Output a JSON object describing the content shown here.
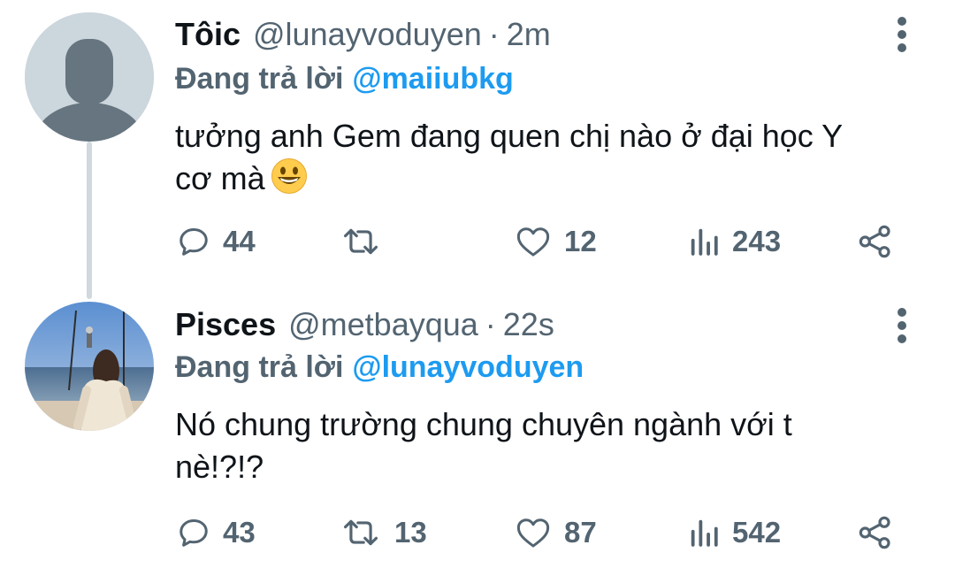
{
  "tweets": [
    {
      "display_name": "Tôic",
      "handle": "@lunayvoduyen",
      "separator": "·",
      "time": "2m",
      "replying_label": "Đang trả lời",
      "replying_to": "@maiiubkg",
      "text_line1": "tưởng anh Gem đang quen chị nào ở đại học Y",
      "text_line2": "cơ mà",
      "emoji": "grinning-face-emoji",
      "avatar": "default-avatar-icon",
      "replies": "44",
      "retweets": "",
      "likes": "12",
      "views": "243"
    },
    {
      "display_name": "Pisces",
      "handle": "@metbayqua",
      "separator": "·",
      "time": "22s",
      "replying_label": "Đang trả lời",
      "replying_to": "@lunayvoduyen",
      "text_line1": "Nó chung trường chung chuyên ngành với t",
      "text_line2": "nè!?!?",
      "avatar": "photo-avatar-girl-on-swing",
      "replies": "43",
      "retweets": "13",
      "likes": "87",
      "views": "542"
    }
  ],
  "colors": {
    "text": "#0f1419",
    "secondary": "#536471",
    "mention": "#1d9bf0",
    "thread_line": "#cfd9de"
  },
  "icons": [
    "reply-icon",
    "retweet-icon",
    "like-icon",
    "views-icon",
    "share-icon",
    "more-options-icon"
  ]
}
